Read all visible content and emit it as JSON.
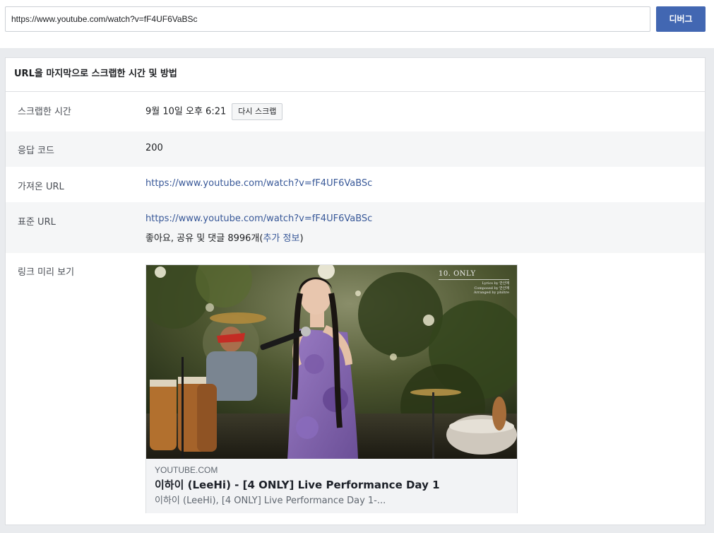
{
  "search": {
    "value": "https://www.youtube.com/watch?v=fF4UF6VaBSc",
    "debug_label": "디버그"
  },
  "panel": {
    "header": "URL을 마지막으로 스크랩한 시간 및 방법",
    "scraped": {
      "label": "스크랩한 시간",
      "value": "9월 10일 오후 6:21",
      "rescrape_label": "다시 스크랩"
    },
    "response": {
      "label": "응답 코드",
      "value": "200"
    },
    "fetched": {
      "label": "가져온 URL",
      "value": "https://www.youtube.com/watch?v=fF4UF6VaBSc"
    },
    "canonical": {
      "label": "표준 URL",
      "value": "https://www.youtube.com/watch?v=fF4UF6VaBSc",
      "engagement_prefix": "좋아요, 공유 및 댓글 8996개(",
      "more_info": "추가 정보",
      "engagement_suffix": ")"
    },
    "preview": {
      "label": "링크 미리 보기",
      "overlay_title": "10. ONLY",
      "overlay_lyrics": "Lyrics by 안신애",
      "overlay_composed": "Composed by 안신애",
      "overlay_arranged": "Arranged by philtre",
      "domain": "YOUTUBE.COM",
      "title": "이하이 (LeeHi) - [4 ONLY] Live Performance Day 1",
      "description": "이하이 (LeeHi), [4 ONLY] Live Performance Day 1-..."
    }
  }
}
